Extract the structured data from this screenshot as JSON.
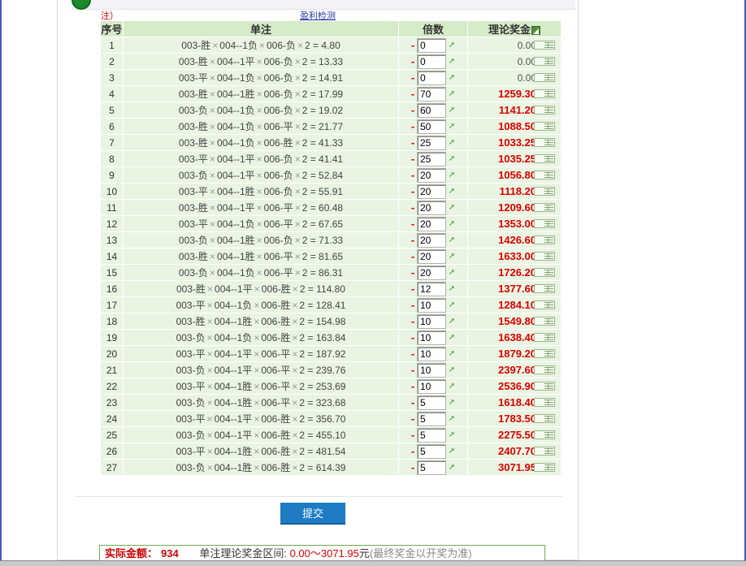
{
  "top_bar": {
    "text_left": "",
    "text_red": ""
  },
  "note": {
    "text": "注）",
    "link": "盈利检测"
  },
  "table": {
    "headers": {
      "seq": "序号",
      "bet": "单注",
      "multiple": "倍数",
      "prize": "理论奖金"
    },
    "rows": [
      {
        "seq": "1",
        "m1": "003-胜",
        "m2": "004--1负",
        "m3": "006-负",
        "odds": "2 = 4.80",
        "mult": "0",
        "prize": "0.00"
      },
      {
        "seq": "2",
        "m1": "003-胜",
        "m2": "004--1平",
        "m3": "006-负",
        "odds": "2 = 13.33",
        "mult": "0",
        "prize": "0.00"
      },
      {
        "seq": "3",
        "m1": "003-平",
        "m2": "004--1负",
        "m3": "006-负",
        "odds": "2 = 14.91",
        "mult": "0",
        "prize": "0.00"
      },
      {
        "seq": "4",
        "m1": "003-胜",
        "m2": "004--1胜",
        "m3": "006-负",
        "odds": "2 = 17.99",
        "mult": "70",
        "prize": "1259.30"
      },
      {
        "seq": "5",
        "m1": "003-负",
        "m2": "004--1负",
        "m3": "006-负",
        "odds": "2 = 19.02",
        "mult": "60",
        "prize": "1141.20"
      },
      {
        "seq": "6",
        "m1": "003-胜",
        "m2": "004--1负",
        "m3": "006-平",
        "odds": "2 = 21.77",
        "mult": "50",
        "prize": "1088.50"
      },
      {
        "seq": "7",
        "m1": "003-胜",
        "m2": "004--1负",
        "m3": "006-胜",
        "odds": "2 = 41.33",
        "mult": "25",
        "prize": "1033.25"
      },
      {
        "seq": "8",
        "m1": "003-平",
        "m2": "004--1平",
        "m3": "006-负",
        "odds": "2 = 41.41",
        "mult": "25",
        "prize": "1035.25"
      },
      {
        "seq": "9",
        "m1": "003-负",
        "m2": "004--1平",
        "m3": "006-负",
        "odds": "2 = 52.84",
        "mult": "20",
        "prize": "1056.80"
      },
      {
        "seq": "10",
        "m1": "003-平",
        "m2": "004--1胜",
        "m3": "006-负",
        "odds": "2 = 55.91",
        "mult": "20",
        "prize": "1118.20"
      },
      {
        "seq": "11",
        "m1": "003-胜",
        "m2": "004--1平",
        "m3": "006-平",
        "odds": "2 = 60.48",
        "mult": "20",
        "prize": "1209.60"
      },
      {
        "seq": "12",
        "m1": "003-平",
        "m2": "004--1负",
        "m3": "006-平",
        "odds": "2 = 67.65",
        "mult": "20",
        "prize": "1353.00"
      },
      {
        "seq": "13",
        "m1": "003-负",
        "m2": "004--1胜",
        "m3": "006-负",
        "odds": "2 = 71.33",
        "mult": "20",
        "prize": "1426.60"
      },
      {
        "seq": "14",
        "m1": "003-胜",
        "m2": "004--1胜",
        "m3": "006-平",
        "odds": "2 = 81.65",
        "mult": "20",
        "prize": "1633.00"
      },
      {
        "seq": "15",
        "m1": "003-负",
        "m2": "004--1负",
        "m3": "006-平",
        "odds": "2 = 86.31",
        "mult": "20",
        "prize": "1726.20"
      },
      {
        "seq": "16",
        "m1": "003-胜",
        "m2": "004--1平",
        "m3": "006-胜",
        "odds": "2 = 114.80",
        "mult": "12",
        "prize": "1377.60"
      },
      {
        "seq": "17",
        "m1": "003-平",
        "m2": "004--1负",
        "m3": "006-胜",
        "odds": "2 = 128.41",
        "mult": "10",
        "prize": "1284.10"
      },
      {
        "seq": "18",
        "m1": "003-胜",
        "m2": "004--1胜",
        "m3": "006-胜",
        "odds": "2 = 154.98",
        "mult": "10",
        "prize": "1549.80"
      },
      {
        "seq": "19",
        "m1": "003-负",
        "m2": "004--1负",
        "m3": "006-胜",
        "odds": "2 = 163.84",
        "mult": "10",
        "prize": "1638.40"
      },
      {
        "seq": "20",
        "m1": "003-平",
        "m2": "004--1平",
        "m3": "006-平",
        "odds": "2 = 187.92",
        "mult": "10",
        "prize": "1879.20"
      },
      {
        "seq": "21",
        "m1": "003-负",
        "m2": "004--1平",
        "m3": "006-平",
        "odds": "2 = 239.76",
        "mult": "10",
        "prize": "2397.60"
      },
      {
        "seq": "22",
        "m1": "003-平",
        "m2": "004--1胜",
        "m3": "006-平",
        "odds": "2 = 253.69",
        "mult": "10",
        "prize": "2536.90"
      },
      {
        "seq": "23",
        "m1": "003-负",
        "m2": "004--1胜",
        "m3": "006-平",
        "odds": "2 = 323.68",
        "mult": "5",
        "prize": "1618.40"
      },
      {
        "seq": "24",
        "m1": "003-平",
        "m2": "004--1平",
        "m3": "006-胜",
        "odds": "2 = 356.70",
        "mult": "5",
        "prize": "1783.50"
      },
      {
        "seq": "25",
        "m1": "003-负",
        "m2": "004--1平",
        "m3": "006-胜",
        "odds": "2 = 455.10",
        "mult": "5",
        "prize": "2275.50"
      },
      {
        "seq": "26",
        "m1": "003-平",
        "m2": "004--1胜",
        "m3": "006-胜",
        "odds": "2 = 481.54",
        "mult": "5",
        "prize": "2407.70"
      },
      {
        "seq": "27",
        "m1": "003-负",
        "m2": "004--1胜",
        "m3": "006-胜",
        "odds": "2 = 614.39",
        "mult": "5",
        "prize": "3071.95"
      }
    ],
    "minus_glyph": "-",
    "plus_glyph": "+",
    "times_glyph": "×"
  },
  "submit": {
    "label": "提交"
  },
  "summary": {
    "actual_label": "实际金额：",
    "actual_value": "934",
    "range_label": "单注理论奖金区间:",
    "range_value": "0.00～3071.95",
    "unit": "元",
    "tip": "(最终奖金以开奖为准)"
  },
  "colors": {
    "header_bg": "#d6ebc8",
    "row_bg": "#eaf4e2",
    "prize_red": "#dd0000",
    "submit_blue": "#1e7cc4"
  }
}
